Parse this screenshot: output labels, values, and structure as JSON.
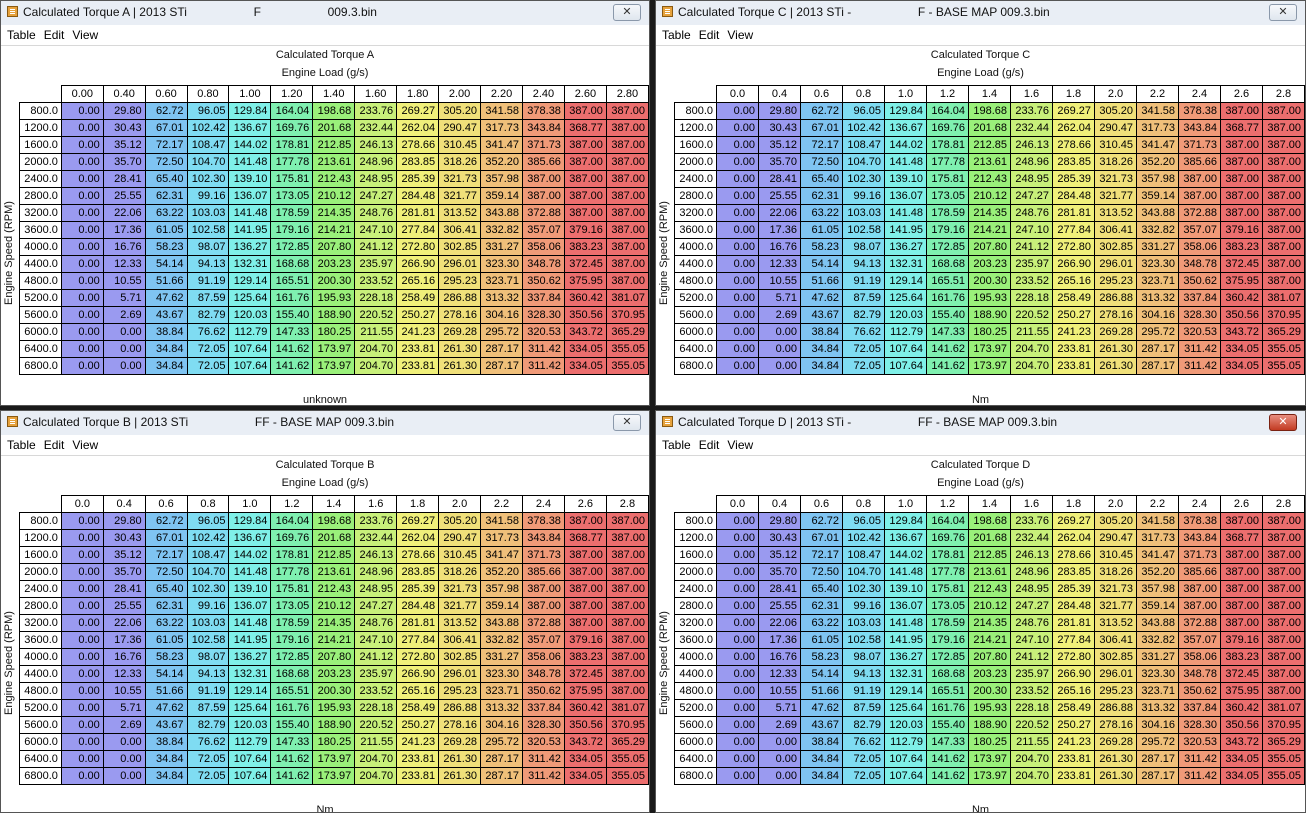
{
  "menu": [
    "Table",
    "Edit",
    "View"
  ],
  "axis_title": "Engine Load (g/s)",
  "y_axis_title": "Engine Speed (RPM)",
  "rpm": [
    "800.0",
    "1200.0",
    "1600.0",
    "2000.0",
    "2400.0",
    "2800.0",
    "3200.0",
    "3600.0",
    "4000.0",
    "4400.0",
    "4800.0",
    "5200.0",
    "5600.0",
    "6000.0",
    "6400.0",
    "6800.0"
  ],
  "values": [
    [
      "0.00",
      "29.80",
      "62.72",
      "96.05",
      "129.84",
      "164.04",
      "198.68",
      "233.76",
      "269.27",
      "305.20",
      "341.58",
      "378.38",
      "387.00",
      "387.00"
    ],
    [
      "0.00",
      "30.43",
      "67.01",
      "102.42",
      "136.67",
      "169.76",
      "201.68",
      "232.44",
      "262.04",
      "290.47",
      "317.73",
      "343.84",
      "368.77",
      "387.00"
    ],
    [
      "0.00",
      "35.12",
      "72.17",
      "108.47",
      "144.02",
      "178.81",
      "212.85",
      "246.13",
      "278.66",
      "310.45",
      "341.47",
      "371.73",
      "387.00",
      "387.00"
    ],
    [
      "0.00",
      "35.70",
      "72.50",
      "104.70",
      "141.48",
      "177.78",
      "213.61",
      "248.96",
      "283.85",
      "318.26",
      "352.20",
      "385.66",
      "387.00",
      "387.00"
    ],
    [
      "0.00",
      "28.41",
      "65.40",
      "102.30",
      "139.10",
      "175.81",
      "212.43",
      "248.95",
      "285.39",
      "321.73",
      "357.98",
      "387.00",
      "387.00",
      "387.00"
    ],
    [
      "0.00",
      "25.55",
      "62.31",
      "99.16",
      "136.07",
      "173.05",
      "210.12",
      "247.27",
      "284.48",
      "321.77",
      "359.14",
      "387.00",
      "387.00",
      "387.00"
    ],
    [
      "0.00",
      "22.06",
      "63.22",
      "103.03",
      "141.48",
      "178.59",
      "214.35",
      "248.76",
      "281.81",
      "313.52",
      "343.88",
      "372.88",
      "387.00",
      "387.00"
    ],
    [
      "0.00",
      "17.36",
      "61.05",
      "102.58",
      "141.95",
      "179.16",
      "214.21",
      "247.10",
      "277.84",
      "306.41",
      "332.82",
      "357.07",
      "379.16",
      "387.00"
    ],
    [
      "0.00",
      "16.76",
      "58.23",
      "98.07",
      "136.27",
      "172.85",
      "207.80",
      "241.12",
      "272.80",
      "302.85",
      "331.27",
      "358.06",
      "383.23",
      "387.00"
    ],
    [
      "0.00",
      "12.33",
      "54.14",
      "94.13",
      "132.31",
      "168.68",
      "203.23",
      "235.97",
      "266.90",
      "296.01",
      "323.30",
      "348.78",
      "372.45",
      "387.00"
    ],
    [
      "0.00",
      "10.55",
      "51.66",
      "91.19",
      "129.14",
      "165.51",
      "200.30",
      "233.52",
      "265.16",
      "295.23",
      "323.71",
      "350.62",
      "375.95",
      "387.00"
    ],
    [
      "0.00",
      "5.71",
      "47.62",
      "87.59",
      "125.64",
      "161.76",
      "195.93",
      "228.18",
      "258.49",
      "286.88",
      "313.32",
      "337.84",
      "360.42",
      "381.07"
    ],
    [
      "0.00",
      "2.69",
      "43.67",
      "82.79",
      "120.03",
      "155.40",
      "188.90",
      "220.52",
      "250.27",
      "278.16",
      "304.16",
      "328.30",
      "350.56",
      "370.95"
    ],
    [
      "0.00",
      "0.00",
      "38.84",
      "76.62",
      "112.79",
      "147.33",
      "180.25",
      "211.55",
      "241.23",
      "269.28",
      "295.72",
      "320.53",
      "343.72",
      "365.29"
    ],
    [
      "0.00",
      "0.00",
      "34.84",
      "72.05",
      "107.64",
      "141.62",
      "173.97",
      "204.70",
      "233.81",
      "261.30",
      "287.17",
      "311.42",
      "334.05",
      "355.05"
    ],
    [
      "0.00",
      "0.00",
      "34.84",
      "72.05",
      "107.64",
      "141.62",
      "173.97",
      "204.70",
      "233.81",
      "261.30",
      "287.17",
      "311.42",
      "334.05",
      "355.05"
    ]
  ],
  "cell_colors": [
    "#9a9af0",
    "#9a9af0",
    "#7fc4f2",
    "#7fdcf2",
    "#7ff0e8",
    "#7ff0b0",
    "#9af07a",
    "#c8f07a",
    "#f0f07a",
    "#f0e07a",
    "#f0c07a",
    "#f09a78",
    "#ec6e6e",
    "#ec6e6e"
  ],
  "windows": [
    {
      "id": "A",
      "title": "Calculated Torque A | 2013 STi                    F                    009.3.bin",
      "table_title": "Calculated Torque A",
      "unit": "unknown",
      "load": [
        "0.00",
        "0.40",
        "0.60",
        "0.80",
        "1.00",
        "1.20",
        "1.40",
        "1.60",
        "1.80",
        "2.00",
        "2.20",
        "2.40",
        "2.60",
        "2.80"
      ],
      "close": "✕",
      "close_active": false
    },
    {
      "id": "C",
      "title": "Calculated Torque C | 2013 STi -                    F - BASE MAP 009.3.bin",
      "table_title": "Calculated Torque C",
      "unit": "Nm",
      "load": [
        "0.0",
        "0.4",
        "0.6",
        "0.8",
        "1.0",
        "1.2",
        "1.4",
        "1.6",
        "1.8",
        "2.0",
        "2.2",
        "2.4",
        "2.6",
        "2.8"
      ],
      "close": "✕",
      "close_active": false
    },
    {
      "id": "B",
      "title": "Calculated Torque B | 2013 STi                    FF - BASE MAP 009.3.bin",
      "table_title": "Calculated Torque B",
      "unit": "Nm",
      "load": [
        "0.0",
        "0.4",
        "0.6",
        "0.8",
        "1.0",
        "1.2",
        "1.4",
        "1.6",
        "1.8",
        "2.0",
        "2.2",
        "2.4",
        "2.6",
        "2.8"
      ],
      "close": "✕",
      "close_active": false
    },
    {
      "id": "D",
      "title": "Calculated Torque D | 2013 STi -                    FF - BASE MAP 009.3.bin",
      "table_title": "Calculated Torque D",
      "unit": "Nm",
      "load": [
        "0.0",
        "0.4",
        "0.6",
        "0.8",
        "1.0",
        "1.2",
        "1.4",
        "1.6",
        "1.8",
        "2.0",
        "2.2",
        "2.4",
        "2.6",
        "2.8"
      ],
      "close": "✕",
      "close_active": true
    }
  ]
}
